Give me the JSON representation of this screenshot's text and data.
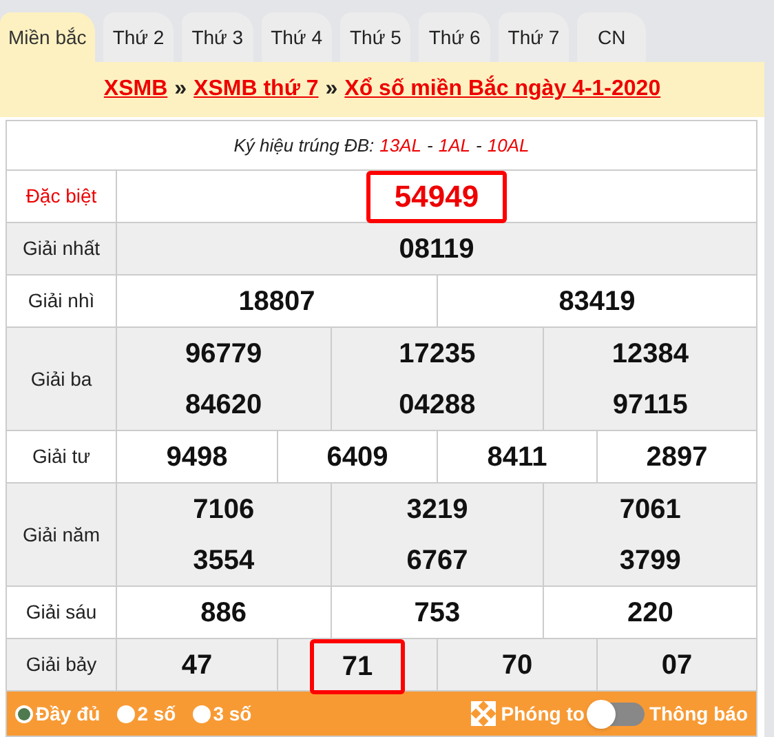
{
  "tabs": [
    {
      "label": "Miền bắc",
      "selected": true
    },
    {
      "label": "Thứ 2",
      "selected": false
    },
    {
      "label": "Thứ 3",
      "selected": false
    },
    {
      "label": "Thứ 4",
      "selected": false
    },
    {
      "label": "Thứ 5",
      "selected": false
    },
    {
      "label": "Thứ 6",
      "selected": false
    },
    {
      "label": "Thứ 7",
      "selected": false
    },
    {
      "label": "CN",
      "selected": false
    }
  ],
  "breadcrumb": [
    "XSMB",
    "XSMB thứ 7",
    "Xổ số miền Bắc ngày 4-1-2020"
  ],
  "breadcrumb_separator": "»",
  "code_line": {
    "label": "Ký hiệu trúng ĐB:",
    "codes": [
      "13AL",
      "1AL",
      "10AL"
    ],
    "separator": "-"
  },
  "prizes": [
    {
      "name": "Đặc biệt",
      "kind": "special",
      "rows": [
        [
          {
            "value": "54949",
            "highlighted": true
          }
        ]
      ]
    },
    {
      "name": "Giải nhất",
      "kind": "normal",
      "rows": [
        [
          {
            "value": "08119",
            "highlighted": false
          }
        ]
      ]
    },
    {
      "name": "Giải nhì",
      "kind": "normal",
      "rows": [
        [
          {
            "value": "18807",
            "highlighted": false
          },
          {
            "value": "83419",
            "highlighted": false
          }
        ]
      ]
    },
    {
      "name": "Giải ba",
      "kind": "normal",
      "rows": [
        [
          {
            "value": "96779",
            "highlighted": false
          },
          {
            "value": "17235",
            "highlighted": false
          },
          {
            "value": "12384",
            "highlighted": false
          }
        ],
        [
          {
            "value": "84620",
            "highlighted": false
          },
          {
            "value": "04288",
            "highlighted": false
          },
          {
            "value": "97115",
            "highlighted": false
          }
        ]
      ]
    },
    {
      "name": "Giải tư",
      "kind": "normal",
      "rows": [
        [
          {
            "value": "9498",
            "highlighted": false
          },
          {
            "value": "6409",
            "highlighted": false
          },
          {
            "value": "8411",
            "highlighted": false
          },
          {
            "value": "2897",
            "highlighted": false
          }
        ]
      ]
    },
    {
      "name": "Giải năm",
      "kind": "normal",
      "rows": [
        [
          {
            "value": "7106",
            "highlighted": false
          },
          {
            "value": "3219",
            "highlighted": false
          },
          {
            "value": "7061",
            "highlighted": false
          }
        ],
        [
          {
            "value": "3554",
            "highlighted": false
          },
          {
            "value": "6767",
            "highlighted": false
          },
          {
            "value": "3799",
            "highlighted": false
          }
        ]
      ]
    },
    {
      "name": "Giải sáu",
      "kind": "normal",
      "rows": [
        [
          {
            "value": "886",
            "highlighted": false
          },
          {
            "value": "753",
            "highlighted": false
          },
          {
            "value": "220",
            "highlighted": false
          }
        ]
      ]
    },
    {
      "name": "Giải bảy",
      "kind": "normal",
      "rows": [
        [
          {
            "value": "47",
            "highlighted": false
          },
          {
            "value": "71",
            "highlighted": true
          },
          {
            "value": "70",
            "highlighted": false
          },
          {
            "value": "07",
            "highlighted": false
          }
        ]
      ]
    }
  ],
  "footer": {
    "options": [
      {
        "label": "Đầy đủ",
        "selected": true
      },
      {
        "label": "2 số",
        "selected": false
      },
      {
        "label": "3 số",
        "selected": false
      }
    ],
    "zoom_label": "Phóng to",
    "toggle": {
      "label": "Thông báo",
      "on": false
    }
  }
}
